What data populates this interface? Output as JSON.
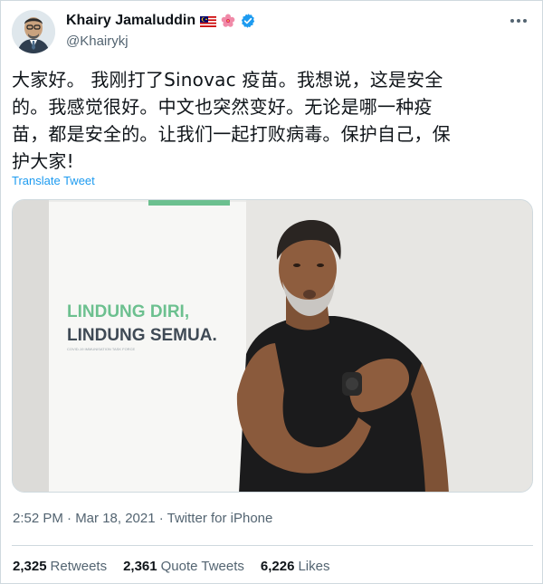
{
  "author": {
    "display_name": "Khairy Jamaluddin",
    "handle": "@Khairykj",
    "verified": true,
    "badges": [
      "malaysia-flag-icon",
      "hibiscus-icon"
    ]
  },
  "tweet": {
    "lines": [
      "大家好。 我刚打了Sinovac 疫苗。我想说，这是安全",
      "的。我感觉很好。中文也突然变好。无论是哪一种疫",
      "苗，都是安全的。让我们一起打败病毒。保护自己，保",
      "护大家!"
    ],
    "translate_label": "Translate Tweet",
    "timestamp": "2:52 PM · Mar 18, 2021 · ",
    "source": "Twitter for iPhone"
  },
  "media": {
    "banner_line1": "LINDUNG DIRI,",
    "banner_line2": "LINDUNG SEMUA.",
    "banner_small": "COVID-19 IMMUNISATION TASK FORCE"
  },
  "stats": {
    "retweets_count": "2,325",
    "retweets_label": "Retweets",
    "quotes_count": "2,361",
    "quotes_label": "Quote Tweets",
    "likes_count": "6,226",
    "likes_label": "Likes"
  },
  "colors": {
    "accent": "#1d9bf0",
    "banner_green": "#6cc08f",
    "banner_dark": "#3f4a55"
  }
}
